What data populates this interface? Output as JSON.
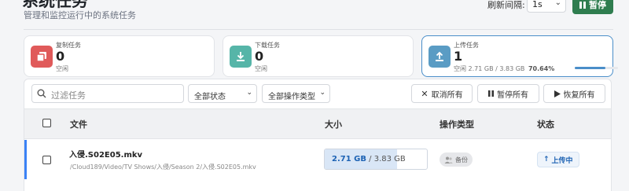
{
  "header": {
    "title": "系统任务",
    "subtitle": "管理和监控运行中的系统任务",
    "refresh_label": "刷新间隔:",
    "refresh_value": "1s",
    "pause_label": "暂停"
  },
  "cards": [
    {
      "label": "复制任务",
      "count": "0",
      "status": "空闲",
      "color": "#e05a5a",
      "icon": "copy-icon"
    },
    {
      "label": "下载任务",
      "count": "0",
      "status": "空闲",
      "color": "#56b5a8",
      "icon": "download-icon"
    },
    {
      "label": "上传任务",
      "count": "1",
      "status": "空闲",
      "progress_text": "2.71 GB / 3.83 GB",
      "progress_pct_text": "70.64%",
      "progress": 0.7064,
      "color": "#5a9cc4",
      "icon": "upload-icon"
    }
  ],
  "toolbar": {
    "filter_placeholder": "过滤任务",
    "status_select": "全部状态",
    "type_select": "全部操作类型",
    "cancel_all": "取消所有",
    "pause_all": "暂停所有",
    "resume_all": "恢复所有"
  },
  "table": {
    "columns": [
      "文件",
      "大小",
      "操作类型",
      "状态"
    ],
    "rows": [
      {
        "name": "入侵.S02E05.mkv",
        "path": "/Cloud189/Video/TV Shows/入侵/Season 2/入侵.S02E05.mkv",
        "size_done": "2.71 GB",
        "size_total": "3.83 GB",
        "progress": 0.7064,
        "op_type": "备份",
        "status": "上传中"
      }
    ]
  },
  "colors": {
    "accent": "#2f7d4f",
    "link": "#1e63b4"
  }
}
